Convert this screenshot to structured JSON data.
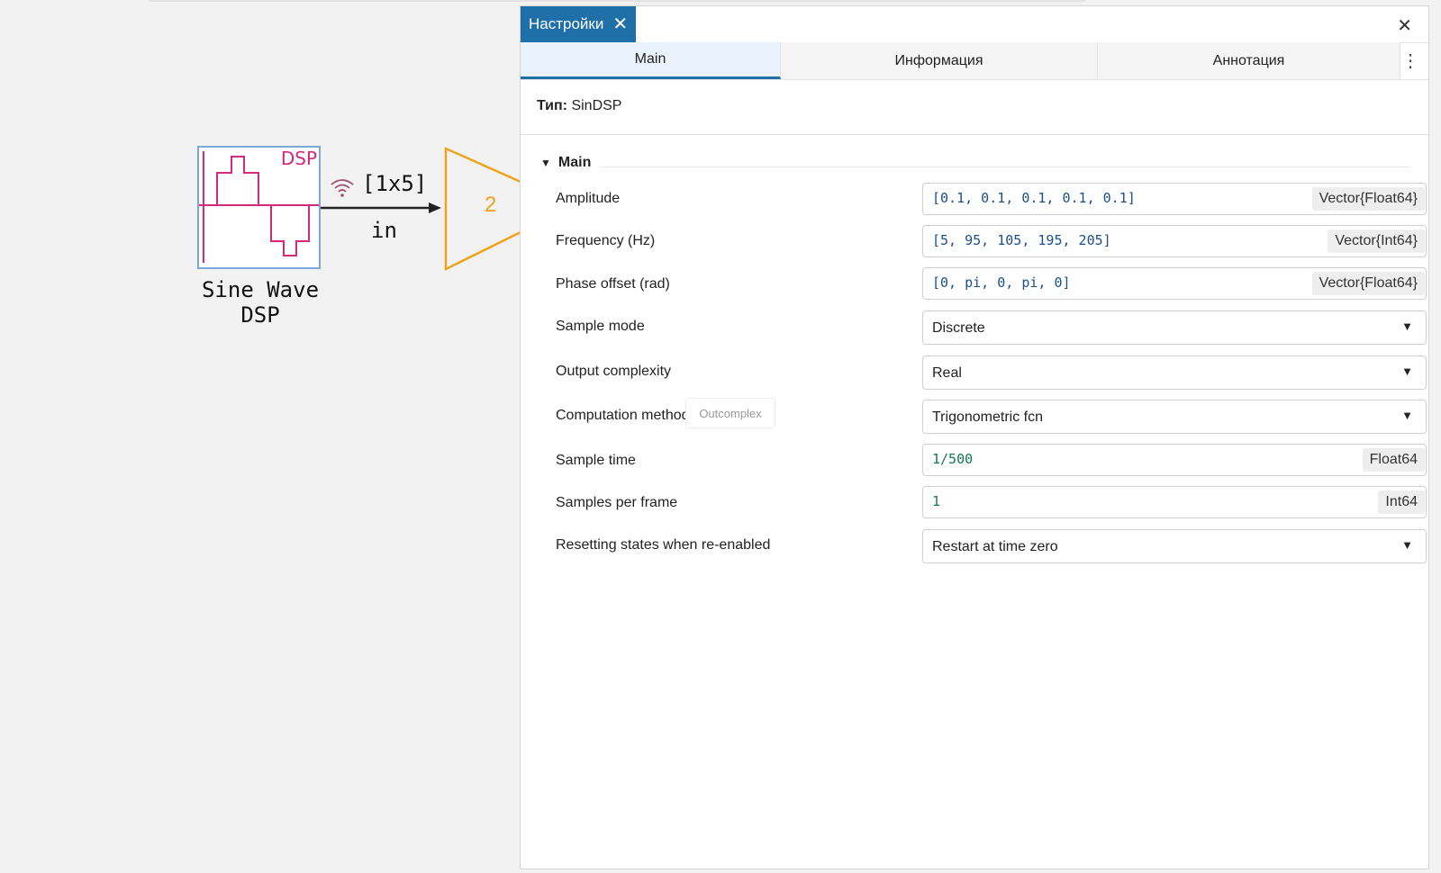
{
  "diagram": {
    "block_tag": "DSP",
    "block_title": "Sine Wave\nDSP",
    "signal_size": "[1x5]",
    "port_label": "in",
    "gain_value": "2",
    "colors": {
      "block_border": "#7ba7d9",
      "dsp_magenta": "#d22a7f",
      "gain_orange": "#f0a31b"
    }
  },
  "panel": {
    "doc_tab": {
      "label": "Настройки",
      "close_icon": "close-icon"
    },
    "close_icon": "close-icon",
    "subtabs": [
      {
        "label": "Main",
        "active": true
      },
      {
        "label": "Информация",
        "active": false
      },
      {
        "label": "Аннотация",
        "active": false
      }
    ],
    "more_icon": "kebab-icon",
    "type_label": "Тип:",
    "type_value": "SinDSP",
    "section_title": "Main",
    "params": [
      {
        "label": "Amplitude",
        "kind": "field",
        "value": "[0.1, 0.1, 0.1, 0.1, 0.1]",
        "type": "Vector{Float64}"
      },
      {
        "label": "Frequency (Hz)",
        "kind": "field",
        "value": "[5, 95, 105, 195, 205]",
        "type": "Vector{Int64}"
      },
      {
        "label": "Phase offset (rad)",
        "kind": "field",
        "value": "[0, pi, 0, pi, 0]",
        "type": "Vector{Float64}"
      },
      {
        "label": "Sample mode",
        "kind": "select",
        "value": "Discrete"
      },
      {
        "label": "Output complexity",
        "kind": "select",
        "value": "Real"
      },
      {
        "label": "Computation method",
        "kind": "select",
        "value": "Trigonometric fcn"
      },
      {
        "label": "Sample time",
        "kind": "field",
        "value": "1/500",
        "type": "Float64"
      },
      {
        "label": "Samples per frame",
        "kind": "field",
        "value": "1",
        "type": "Int64"
      },
      {
        "label": "Resetting states when re-enabled",
        "kind": "select",
        "value": "Restart at time zero"
      }
    ],
    "tooltip": "Outcomplex",
    "accent": "#1f6fa8"
  }
}
